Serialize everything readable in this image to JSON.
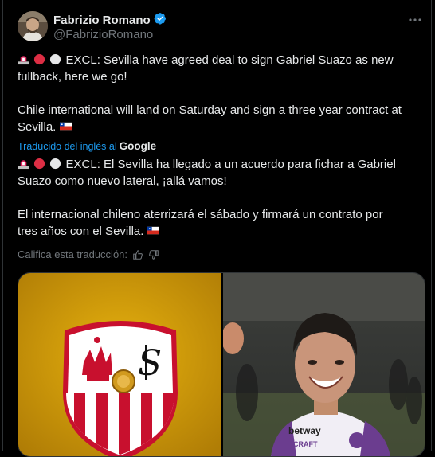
{
  "author": {
    "name": "Fabrizio Romano",
    "handle": "@FabrizioRomano"
  },
  "tweet": {
    "original": {
      "line1": "EXCL: Sevilla have agreed deal to sign Gabriel Suazo as new",
      "line2": "fullback, here we go!",
      "line3": "Chile international will land on Saturday and sign a three year contract at",
      "line4": "Sevilla."
    },
    "translated_label": "Traducido del inglés al",
    "translated_by": "Google",
    "translation": {
      "line1": "EXCL: El Sevilla ha llegado a un acuerdo para fichar a Gabriel",
      "line2": "Suazo como nuevo lateral, ¡allá vamos!",
      "line3": "El internacional chileno aterrizará el sábado y firmará un contrato por",
      "line4": "tres años con el Sevilla."
    },
    "rate_label": "Califica esta traducción:"
  },
  "icons": {
    "verified": "verified-badge-icon",
    "more": "more-dots-icon",
    "siren": "police-light-icon",
    "red_circle": "red-circle-icon",
    "white_circle": "white-circle-icon",
    "flag": "chile-flag-icon",
    "thumb_up": "thumbs-up-icon",
    "thumb_down": "thumbs-down-icon"
  },
  "colors": {
    "background": "#000000",
    "text": "#e7e9ea",
    "secondary": "#71767b",
    "accent": "#1d9bf0",
    "border": "#2f3336"
  }
}
